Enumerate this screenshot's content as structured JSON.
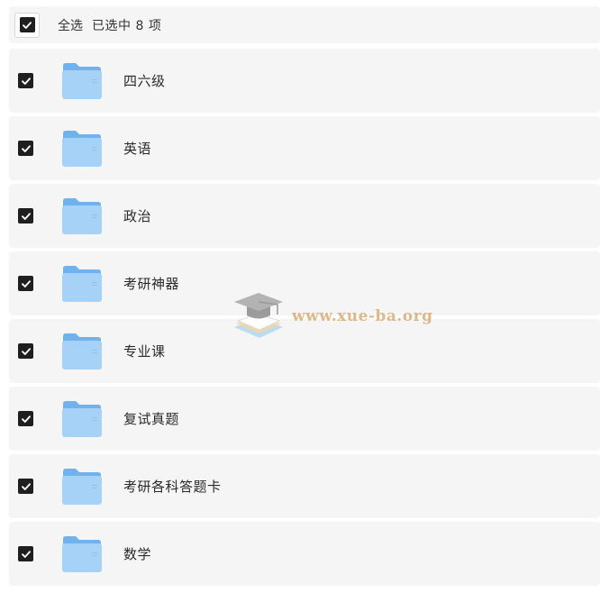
{
  "select_all": {
    "label": "全选",
    "checked": true,
    "selected_prefix": "已选中",
    "selected_count": "8",
    "selected_suffix": "项"
  },
  "files": [
    {
      "name": "四六级",
      "checked": true,
      "icon": "folder-icon"
    },
    {
      "name": "英语",
      "checked": true,
      "icon": "folder-icon"
    },
    {
      "name": "政治",
      "checked": true,
      "icon": "folder-icon"
    },
    {
      "name": "考研神器",
      "checked": true,
      "icon": "folder-icon"
    },
    {
      "name": "专业课",
      "checked": true,
      "icon": "folder-icon"
    },
    {
      "name": "复试真题",
      "checked": true,
      "icon": "folder-icon"
    },
    {
      "name": "考研各科答题卡",
      "checked": true,
      "icon": "folder-icon"
    },
    {
      "name": "数学",
      "checked": true,
      "icon": "folder-icon"
    }
  ],
  "watermark": {
    "text": "www.xue-ba.org",
    "icon": "graduation-cap-icon"
  },
  "colors": {
    "row_background": "#f5f5f6",
    "checkbox_checked": "#1f1f1f",
    "folder_light": "#a6d2f7",
    "folder_dark": "#6fb2ee",
    "watermark_text": "#d6a86c"
  }
}
